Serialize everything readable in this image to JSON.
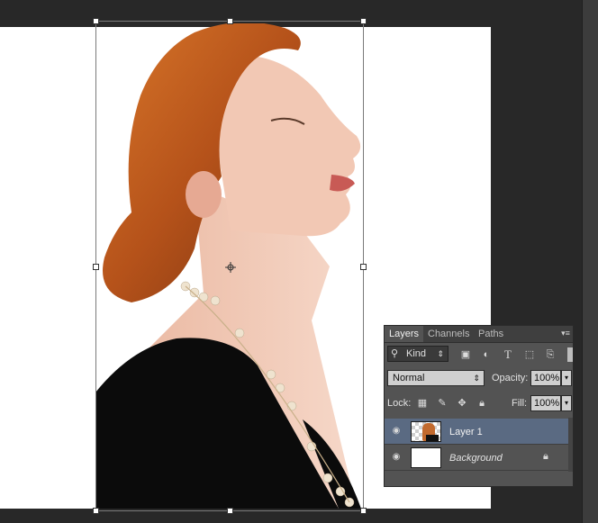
{
  "panel": {
    "tabs": [
      {
        "label": "Layers"
      },
      {
        "label": "Channels"
      },
      {
        "label": "Paths"
      }
    ],
    "menu_icon": "panel-menu-icon",
    "filter": {
      "kind_label": "Kind"
    },
    "blend_mode": "Normal",
    "opacity": {
      "label": "Opacity:",
      "value": "100%"
    },
    "lock": {
      "label": "Lock:"
    },
    "fill": {
      "label": "Fill:",
      "value": "100%"
    },
    "layers": [
      {
        "name": "Layer 1",
        "selected": true
      },
      {
        "name": "Background",
        "locked": true
      }
    ]
  },
  "colors": {
    "workspace": "#282828",
    "panel": "#535353",
    "selected_layer": "#5a6a82"
  }
}
